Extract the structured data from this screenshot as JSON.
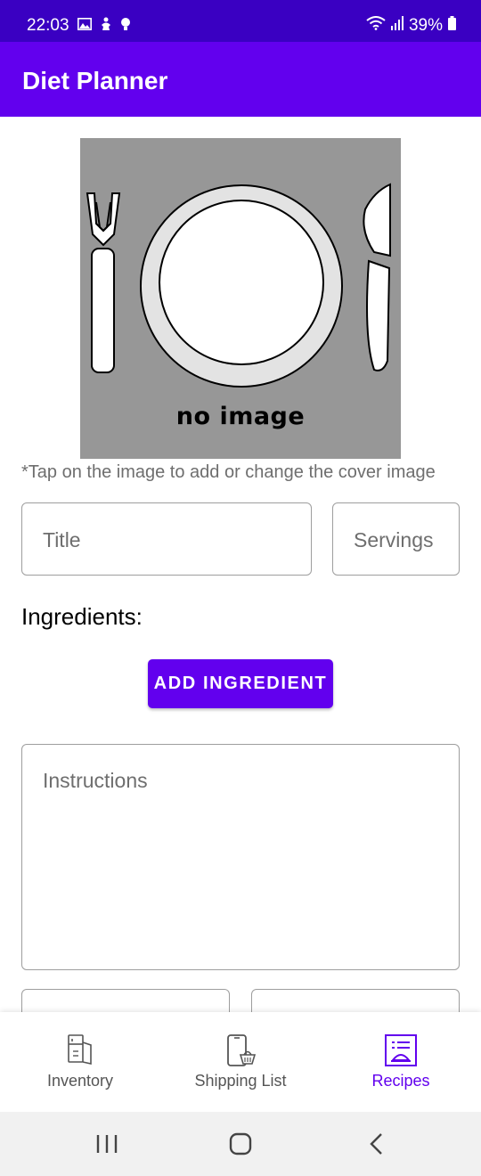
{
  "status_bar": {
    "time": "22:03",
    "battery": "39%",
    "icons_left": [
      "gallery-icon",
      "figure-icon",
      "bulb-icon"
    ],
    "icons_right": [
      "wifi-icon",
      "signal-icon",
      "battery-icon"
    ]
  },
  "app_bar": {
    "title": "Diet Planner",
    "color": "#6200ee"
  },
  "cover": {
    "caption": "no image",
    "hint": "*Tap on the image to add or change the cover image"
  },
  "form": {
    "title_placeholder": "Title",
    "servings_placeholder": "Servings",
    "ingredients_label": "Ingredients:",
    "add_ingredient_label": "ADD INGREDIENT",
    "instructions_placeholder": "Instructions"
  },
  "bottom_nav": {
    "items": [
      {
        "label": "Inventory",
        "icon": "fridge-icon",
        "active": false
      },
      {
        "label": "Shipping List",
        "icon": "phone-basket-icon",
        "active": false
      },
      {
        "label": "Recipes",
        "icon": "recipe-icon",
        "active": true
      }
    ]
  },
  "colors": {
    "status_bar": "#3a00c2",
    "primary": "#6200ee",
    "placeholder": "#6e6e6e",
    "cover_bg": "#979797"
  }
}
